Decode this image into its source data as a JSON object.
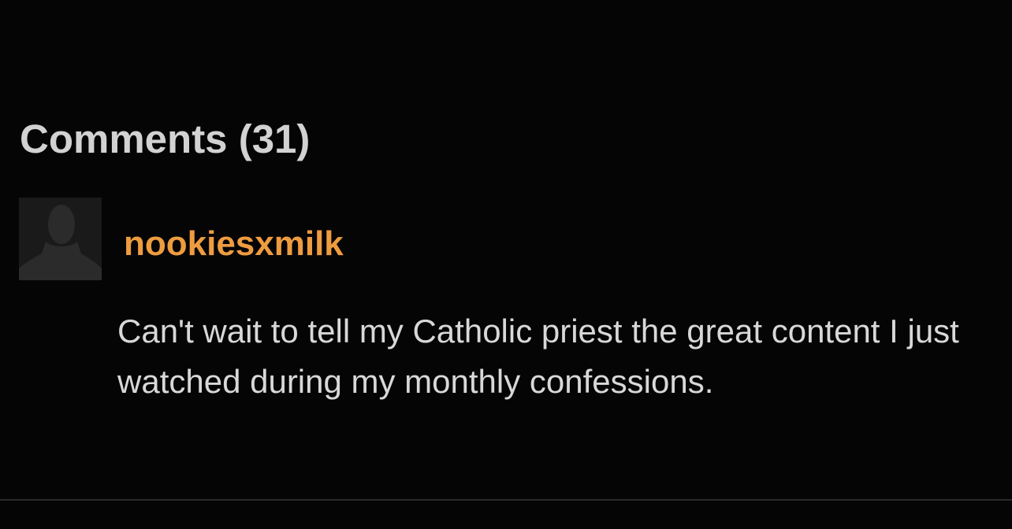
{
  "comments_section": {
    "heading": "Comments (31)",
    "items": [
      {
        "avatar_icon": "default-user-silhouette-icon",
        "username": "nookiesxmilk",
        "text": "Can't wait to tell my Catholic priest the great content I just watched during my monthly confessions."
      }
    ]
  },
  "colors": {
    "background": "#060506",
    "heading": "#d2d2d2",
    "username": "#ee9c40",
    "comment_text": "#d8d8d8",
    "avatar_background": "#1a1a1a",
    "divider": "#2a2a2b"
  }
}
